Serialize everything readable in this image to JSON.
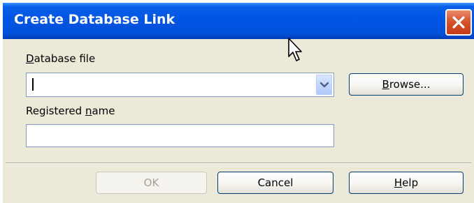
{
  "window": {
    "title": "Create Database Link",
    "close_icon": "close-x-icon"
  },
  "form": {
    "database_file_label": "Database file",
    "database_file_value": "",
    "registered_name_label": "Registered name",
    "registered_name_value": ""
  },
  "buttons": {
    "browse": "Browse...",
    "ok": "OK",
    "cancel": "Cancel",
    "help": "Help"
  },
  "colors": {
    "titlebar": "#0055e5",
    "dialog_bg": "#ece9d8",
    "close_button": "#d5502c",
    "field_border": "#7f9db9"
  }
}
